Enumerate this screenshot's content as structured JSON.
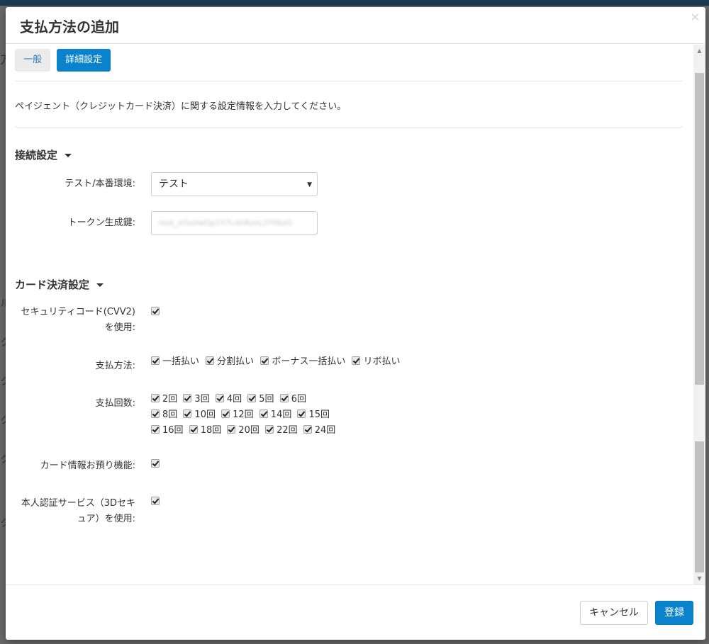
{
  "backdrop": {
    "fragments": [
      "方",
      "ル",
      "ク",
      "ク",
      "ク",
      "ク",
      "ク"
    ]
  },
  "modal": {
    "title": "支払方法の追加",
    "close_label": "×"
  },
  "tabs": [
    {
      "label": "一般",
      "active": false
    },
    {
      "label": "詳細設定",
      "active": true
    }
  ],
  "description": "ペイジェント（クレジットカード決済）に関する設定情報を入力してください。",
  "connection": {
    "title": "接続設定",
    "env_label": "テスト/本番環境:",
    "env_value": "テスト",
    "token_label": "トークン生成鍵:",
    "token_value": "test_xOuiIwOp1Y7LdnRzoL2Y0bd1"
  },
  "card": {
    "title": "カード決済設定",
    "cvv_label_1": "セキュリティコード(CVV2)",
    "cvv_label_2": "を使用:",
    "method_label": "支払方法:",
    "methods": [
      "一括払い",
      "分割払い",
      "ボーナス一括払い",
      "リボ払い"
    ],
    "count_label": "支払回数:",
    "counts_row1": [
      "2回",
      "3回",
      "4回",
      "5回",
      "6回"
    ],
    "counts_row2": [
      "8回",
      "10回",
      "12回",
      "14回",
      "15回"
    ],
    "counts_row3": [
      "16回",
      "18回",
      "20回",
      "22回",
      "24回"
    ],
    "storage_label": "カード情報お預り機能:",
    "auth_label_1": "本人認証サービス（3Dセキ",
    "auth_label_2": "ュア）を使用:"
  },
  "footer": {
    "cancel_label": "キャンセル",
    "submit_label": "登録"
  },
  "colors": {
    "primary": "#0b83cc",
    "topbar": "#1c3a54"
  }
}
